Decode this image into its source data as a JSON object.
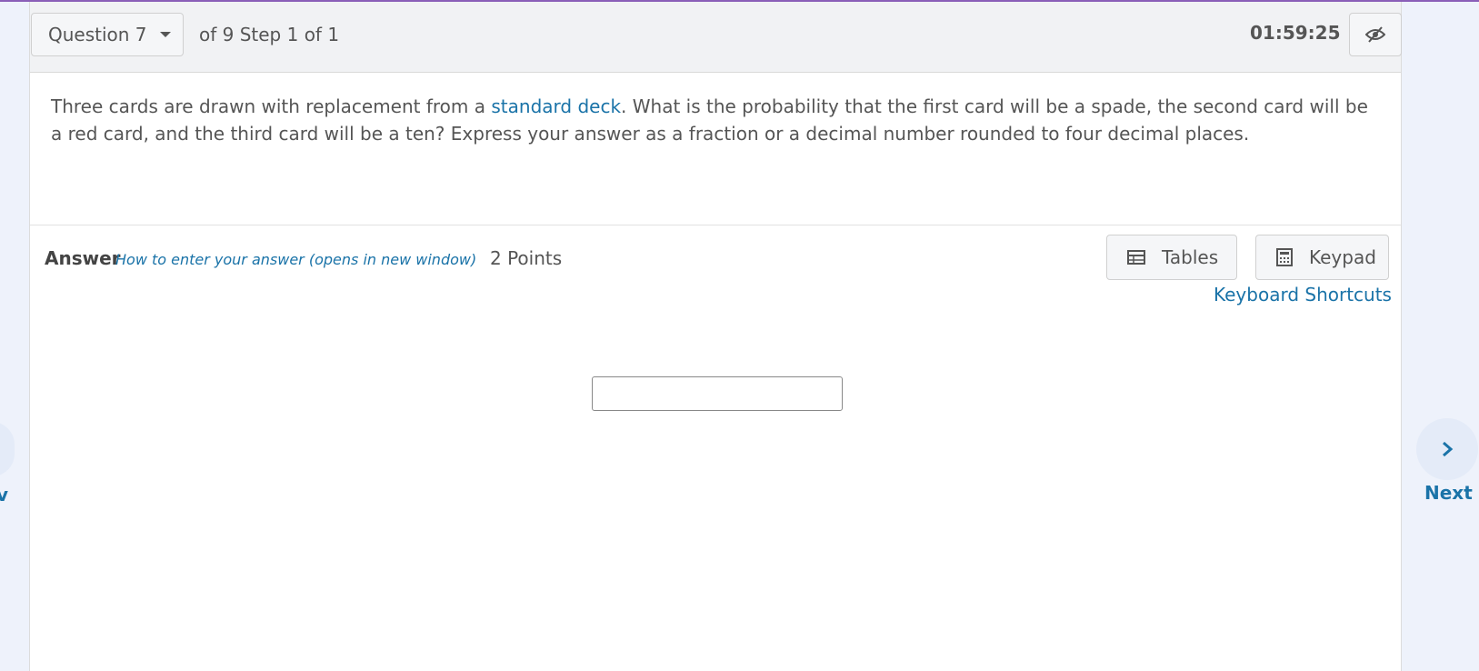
{
  "header": {
    "question_label": "Question 7",
    "step_info": "of 9 Step 1 of 1",
    "timer": "01:59:25"
  },
  "question": {
    "text_before": "Three cards are drawn with replacement from a ",
    "link_text": "standard deck",
    "text_after": ". What is the probability that the first card will be a spade, the second card will be a red card, and the third card will be a ten? Express your answer as a fraction or a decimal number rounded to four decimal places."
  },
  "answer": {
    "label": "Answer",
    "how_to_link": "How to enter your answer (opens in new window)",
    "points": "2 Points",
    "input_value": "",
    "tables_label": "Tables",
    "keypad_label": "Keypad",
    "shortcuts_link": "Keyboard Shortcuts"
  },
  "nav": {
    "prev_label": "v",
    "next_label": "Next"
  },
  "icons": {
    "caret": "chevron-down-icon",
    "hide_timer": "eye-slash-icon",
    "tables": "table-icon",
    "keypad": "calculator-icon",
    "next": "chevron-right-icon"
  },
  "colors": {
    "accent_link": "#1a73a8",
    "top_border": "#8a5fb8",
    "header_bg": "#f1f2f4",
    "page_bg": "#f2f5fb"
  }
}
